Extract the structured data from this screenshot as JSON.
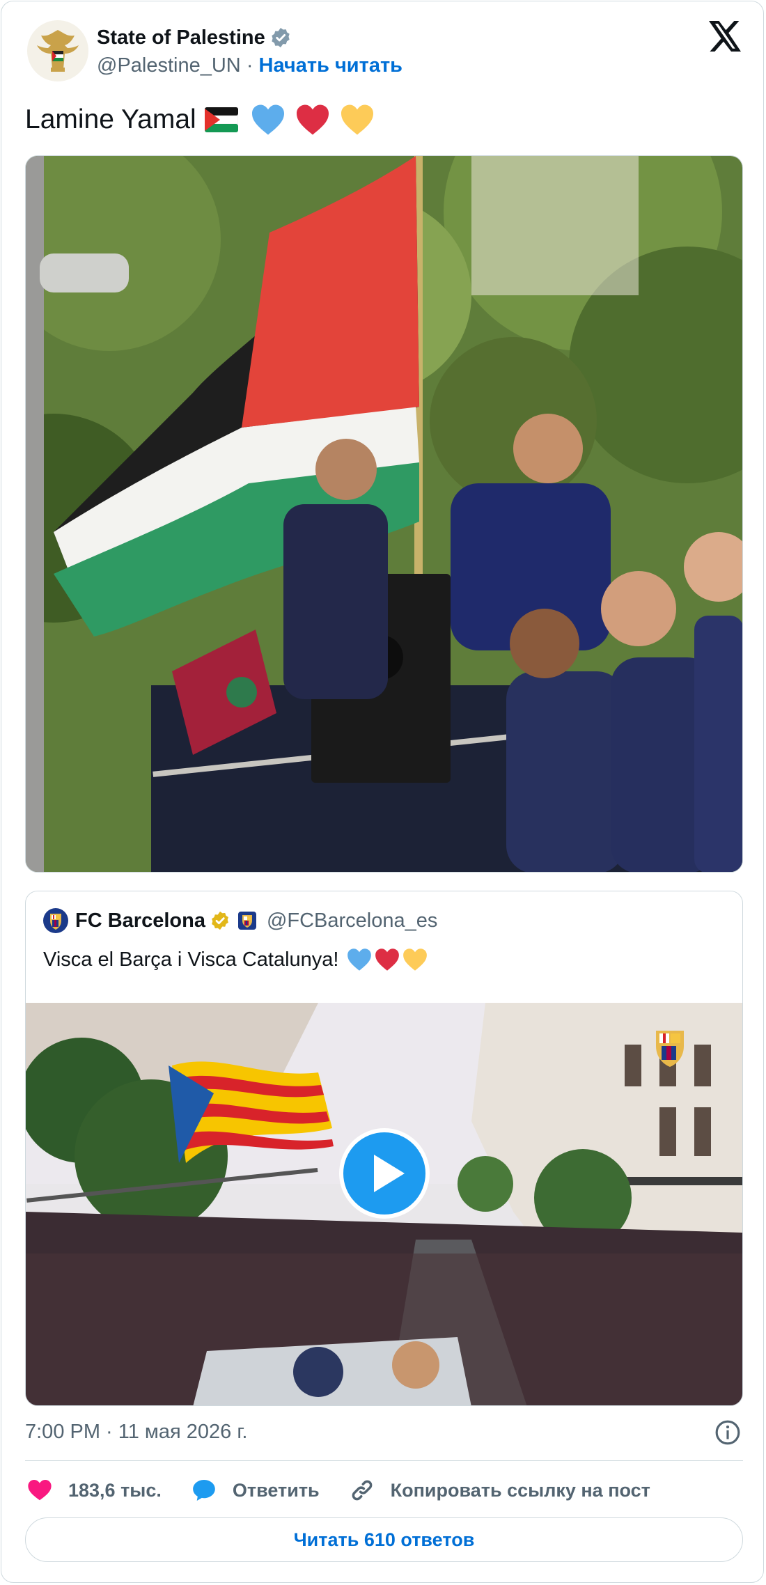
{
  "author": {
    "name": "State of Palestine",
    "handle": "@Palestine_UN",
    "separator": " · ",
    "follow_label": "Начать читать"
  },
  "tweet": {
    "text": "Lamine Yamal",
    "emojis": [
      "palestine-flag",
      "blue-heart",
      "red-heart",
      "yellow-heart"
    ]
  },
  "quote": {
    "name": "FC Barcelona",
    "handle": "@FCBarcelona_es",
    "text": "Visca el Barça i Visca Catalunya!",
    "emojis": [
      "blue-heart",
      "red-heart",
      "yellow-heart"
    ]
  },
  "meta": {
    "timestamp": "7:00 PM · 11 мая 2026 г."
  },
  "actions": {
    "likes": "183,6 тыс.",
    "reply_label": "Ответить",
    "copy_label": "Копировать ссылку на пост"
  },
  "read_replies_label": "Читать 610 ответов",
  "colors": {
    "link": "#006fd6",
    "like": "#f91880",
    "reply": "#1d9bf0",
    "secondary_text": "#536471",
    "border": "#cfd9de"
  }
}
